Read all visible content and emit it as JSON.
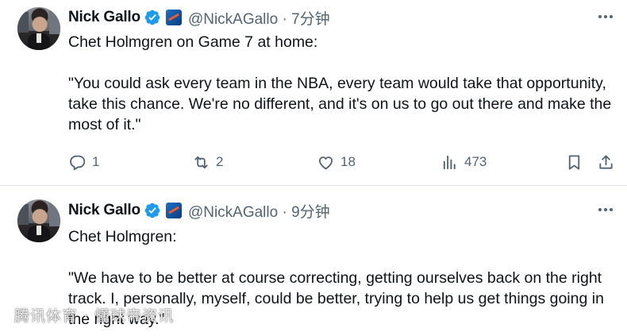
{
  "tweets": [
    {
      "author_name": "Nick Gallo",
      "handle_time": "@NickAGallo · 7分钟",
      "text_line1": "Chet Holmgren on Game 7 at home:",
      "text_quote": "\"You could ask every team in the NBA, every team would take that opportunity, take this chance. We're no different, and it's on us to go out there and make the most of it.\"",
      "replies": "1",
      "retweets": "2",
      "likes": "18",
      "views": "473"
    },
    {
      "author_name": "Nick Gallo",
      "handle_time": "@NickAGallo · 9分钟",
      "text_line1": "Chet Holmgren:",
      "text_quote": "\"We have to be better at course correcting, getting ourselves back on the right track. I, personally, myself, could be better, trying to help us get things going in the right way.\""
    }
  ],
  "watermark": "腾讯体育 · 懂球帝资讯",
  "colors": {
    "verified": "#1d9bf0",
    "muted": "#536471",
    "text": "#0f1419"
  }
}
